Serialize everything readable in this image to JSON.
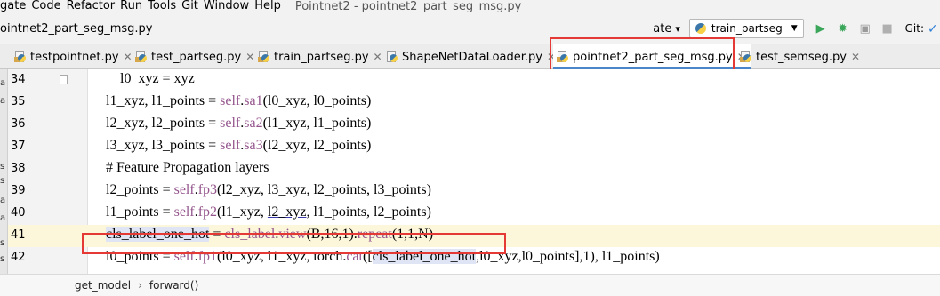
{
  "menubar": {
    "items": [
      "gate",
      "Code",
      "Refactor",
      "Run",
      "Tools",
      "Git",
      "Window",
      "Help"
    ],
    "title": "Pointnet2 - pointnet2_part_seg_msg.py"
  },
  "navbar": {
    "breadcrumb": "ointnet2_part_seg_msg.py",
    "left_fragment": "ate",
    "run_config": "train_partseg",
    "git_label": "Git:"
  },
  "tabs": [
    {
      "label": "testpointnet.py",
      "active": false
    },
    {
      "label": "test_partseg.py",
      "active": false
    },
    {
      "label": "train_partseg.py",
      "active": false
    },
    {
      "label": "ShapeNetDataLoader.py",
      "active": false
    },
    {
      "label": "pointnet2_part_seg_msg.py",
      "active": true
    },
    {
      "label": "test_semseg.py",
      "active": false
    }
  ],
  "editor": {
    "lines": [
      {
        "num": "34",
        "code": "    l0_xyz = xyz"
      },
      {
        "num": "35",
        "code": "l1_xyz, l1_points = self.sa1(l0_xyz, l0_points)"
      },
      {
        "num": "36",
        "code": "l2_xyz, l2_points = self.sa2(l1_xyz, l1_points)"
      },
      {
        "num": "37",
        "code": "l3_xyz, l3_points = self.sa3(l2_xyz, l2_points)"
      },
      {
        "num": "38",
        "code": "# Feature Propagation layers"
      },
      {
        "num": "39",
        "code": "l2_points = self.fp3(l2_xyz, l3_xyz, l2_points, l3_points)"
      },
      {
        "num": "40",
        "code": "l1_points = self.fp2(l1_xyz, l2_xyz, l1_points, l2_points)"
      },
      {
        "num": "41",
        "code": "cls_label_one_hot = cls_label.view(B,16,1).repeat(1,1,N)"
      },
      {
        "num": "42",
        "code": "l0_points = self.fp1(l0_xyz, l1_xyz, torch.cat([cls_label_one_hot,l0_xyz,l0_points],1), l1_points)"
      }
    ],
    "left_strip": [
      "a",
      "a",
      "s",
      "s",
      "a",
      "a",
      "s",
      "s"
    ]
  },
  "bottom_breadcrumb": [
    "get_model",
    "forward()"
  ],
  "colors": {
    "keyword": "#94558d",
    "comment": "#808080",
    "current_line": "#fcf7db",
    "highlight_box": "#e53935",
    "active_tab_underline": "#4a86c8"
  },
  "icons": {
    "run": "play-icon",
    "debug": "bug-icon",
    "coverage": "coverage-icon",
    "stop": "stop-icon",
    "git_update": "check-icon"
  }
}
